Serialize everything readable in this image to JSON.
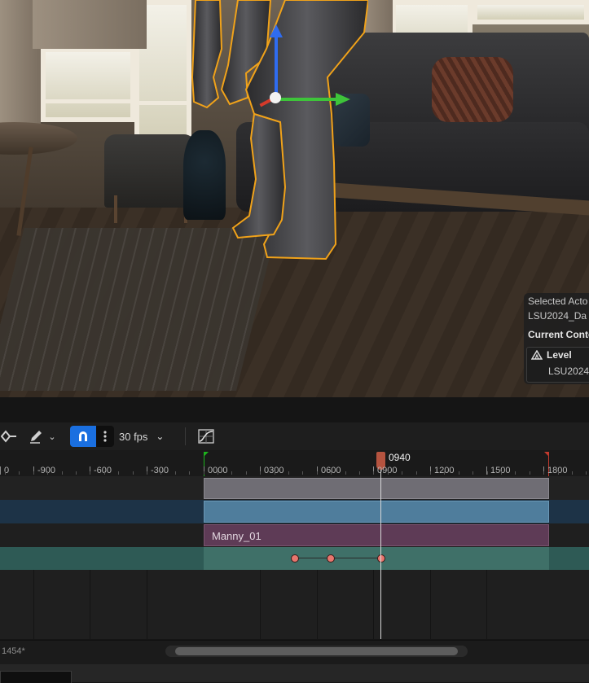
{
  "viewport": {
    "details": {
      "selected_actor_label": "Selected Acto",
      "actor_name": "LSU2024_Da",
      "current_context_label": "Current Conte",
      "level_label": "Level",
      "level_value": "LSU2024"
    }
  },
  "toolbar": {
    "fps_label": "30 fps",
    "snap_active": true,
    "accent_color": "#1a6fe0"
  },
  "timeline": {
    "playhead_frame": "0940",
    "ruler_labels": [
      "0",
      "-900",
      "-600",
      "-300",
      "0000",
      "0300",
      "0600",
      "0900",
      "1200",
      "1500",
      "1800"
    ],
    "tracks": [
      {
        "name": "track-1",
        "color": "#6f6d74"
      },
      {
        "name": "track-2",
        "color": "#4f7d9c"
      },
      {
        "name": "animation-section",
        "label": "Manny_01",
        "color": "#5e3b56"
      },
      {
        "name": "keyframe-track",
        "color": "#3f7068"
      }
    ],
    "keyframe_color": "#e8766e"
  },
  "status": {
    "frame_text": "1454*"
  }
}
